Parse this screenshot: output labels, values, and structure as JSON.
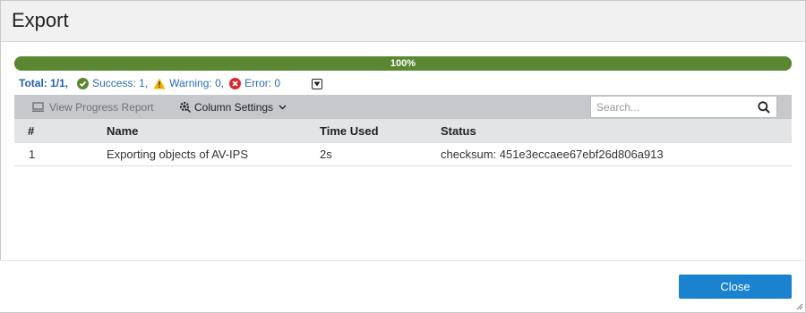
{
  "dialog": {
    "title": "Export"
  },
  "progress": {
    "percent": 100,
    "label": "100%",
    "color": "#5b8732"
  },
  "summary": {
    "total": "Total: 1/1,",
    "success": "Success: 1,",
    "warning": "Warning: 0,",
    "error": "Error: 0",
    "success_icon": "check-circle-icon",
    "warning_icon": "warning-triangle-icon",
    "error_icon": "error-circle-icon",
    "success_color": "#5b8732",
    "warning_color": "#f0b400",
    "error_color": "#d8262a"
  },
  "toolbar": {
    "view_progress_report": "View Progress Report",
    "column_settings": "Column Settings",
    "search_placeholder": "Search..."
  },
  "table": {
    "columns": [
      "#",
      "Name",
      "Time Used",
      "Status"
    ],
    "rows": [
      {
        "num": "1",
        "name": "Exporting objects of AV-IPS",
        "time": "2s",
        "status": "checksum: 451e3eccaee67ebf26d806a913"
      }
    ]
  },
  "footer": {
    "close_label": "Close",
    "accent": "#1a82cf"
  }
}
